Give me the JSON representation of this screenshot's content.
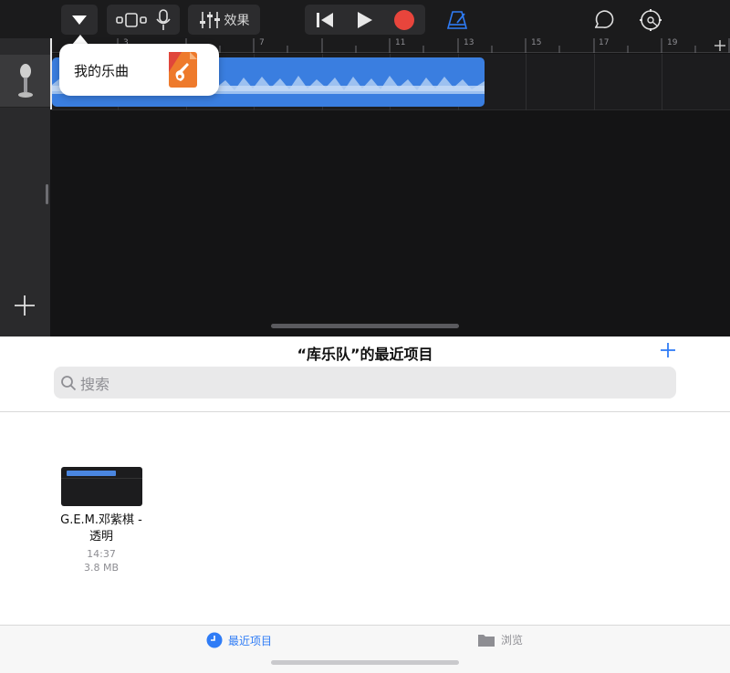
{
  "toolbar": {
    "effects_label": "效果"
  },
  "ruler": {
    "bars": [
      "3",
      "7",
      "11",
      "13",
      "15",
      "17",
      "19"
    ]
  },
  "popover": {
    "label": "我的乐曲"
  },
  "browser": {
    "title": "“库乐队”的最近项目",
    "search_placeholder": "搜索",
    "files": [
      {
        "name_line1": "G.E.M.邓紫棋 -",
        "name_line2": "透明",
        "time": "14:37",
        "size": "3.8 MB"
      }
    ]
  },
  "tabs": {
    "recent": "最近项目",
    "browse": "浏览"
  },
  "colors": {
    "accent": "#2f7cf6",
    "record": "#e8453c",
    "region": "#3a7ee0",
    "daw_bg": "#141415"
  }
}
